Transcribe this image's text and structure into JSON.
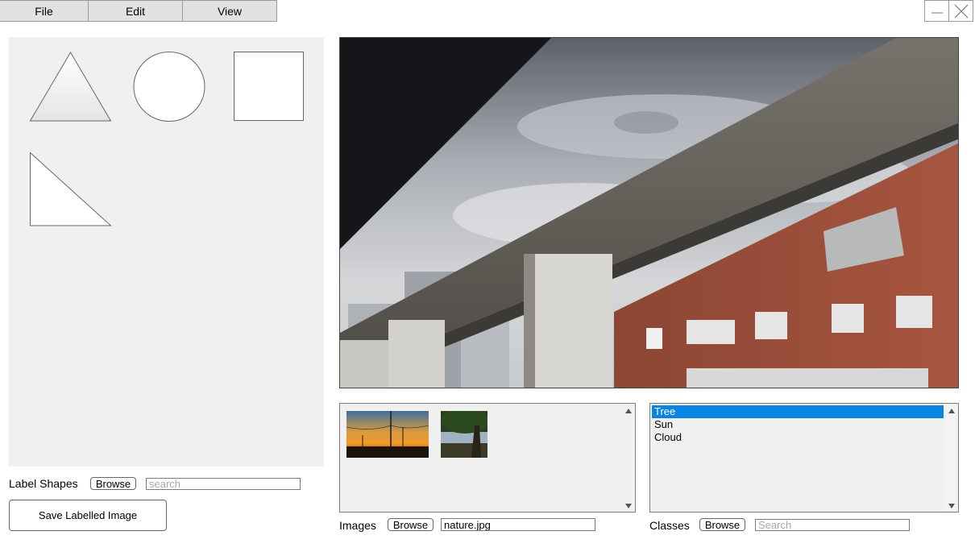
{
  "menu": {
    "file": "File",
    "edit": "Edit",
    "view": "View"
  },
  "window": {
    "minimize_icon": "minimize-icon",
    "close_icon": "close-icon"
  },
  "shapes": [
    "triangle",
    "circle",
    "square",
    "right-triangle"
  ],
  "label_shapes": {
    "label": "Label Shapes",
    "browse": "Browse",
    "search_placeholder": "search"
  },
  "save_button": "Save Labelled Image",
  "images": {
    "label": "Images",
    "browse": "Browse",
    "filename": "nature.jpg",
    "thumbnails": [
      "sunset-power-lines",
      "tree-by-lake"
    ]
  },
  "classes": {
    "label": "Classes",
    "browse": "Browse",
    "search_placeholder": "Search",
    "items": [
      "Tree",
      "Sun",
      "Cloud"
    ],
    "selected": "Tree"
  },
  "colors": {
    "selection": "#0a84e3",
    "panel": "#f0f0f0"
  }
}
